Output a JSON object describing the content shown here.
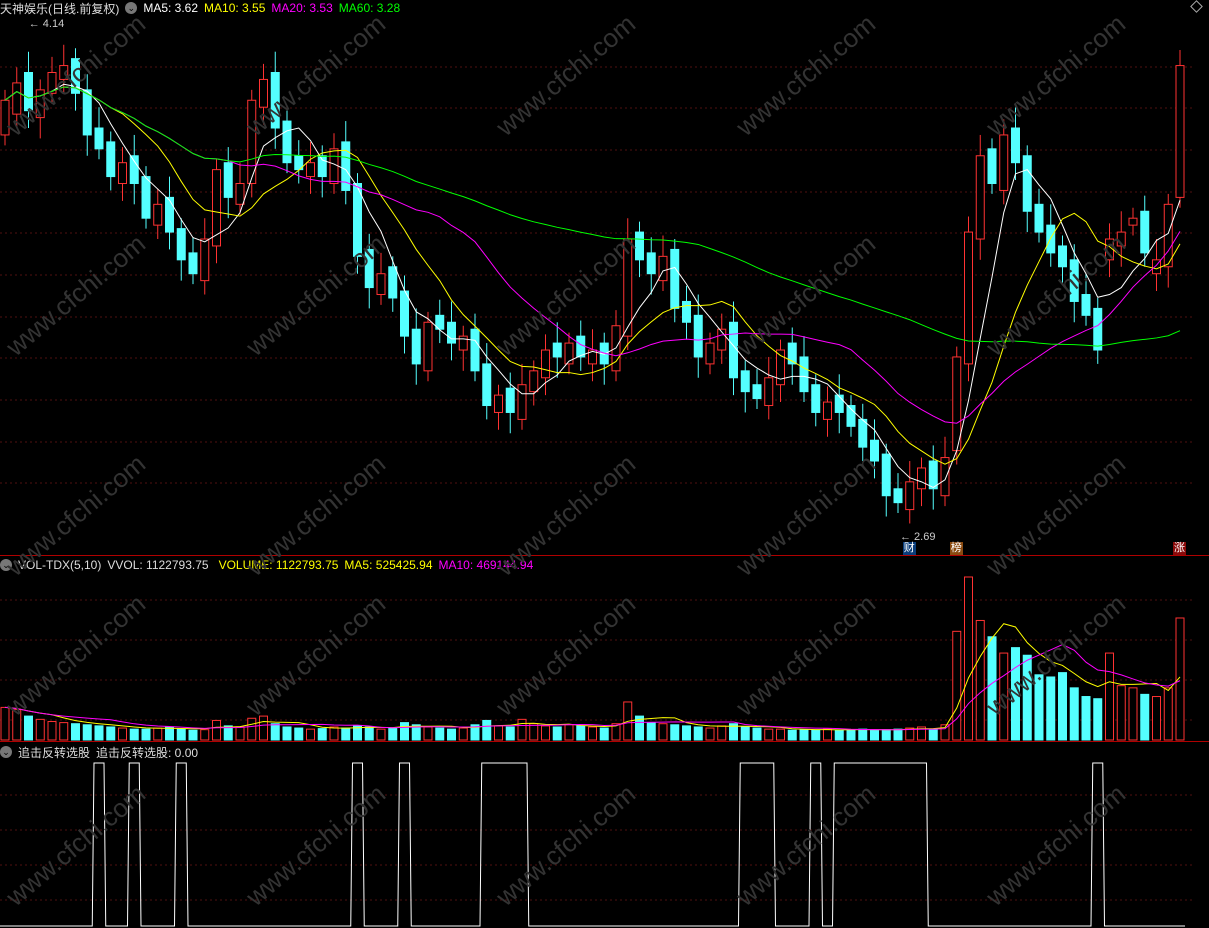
{
  "title": "天神娱乐(日线.前复权)",
  "ma_header": [
    {
      "label": "MA5: 3.62",
      "color": "#ffffff"
    },
    {
      "label": "MA10: 3.55",
      "color": "#ffff00"
    },
    {
      "label": "MA20: 3.53",
      "color": "#ff00ff"
    },
    {
      "label": "MA60: 3.28",
      "color": "#00ff00"
    }
  ],
  "vol_header": {
    "name": "VOL-TDX(5,10)",
    "vvol": "VVOL: 1122793.75",
    "volume": "VOLUME: 1122793.75",
    "ma5": "MA5: 525425.94",
    "ma10": "MA10: 469144.94"
  },
  "ind_header": {
    "name": "追击反转选股",
    "value": "追击反转选股: 0.00"
  },
  "annotations": {
    "high": "4.14",
    "low": "2.69"
  },
  "markers": [
    {
      "text": "财",
      "color": "#0a3d7a",
      "index": 77
    },
    {
      "text": "榜",
      "color": "#8a4a10",
      "index": 81
    },
    {
      "text": "涨",
      "color": "#8a0a0a",
      "index": 100
    }
  ],
  "watermark": "www.cfchi.com",
  "colors": {
    "up": "#ff3232",
    "down": "#54ffff",
    "ma5": "#ffffff",
    "ma10": "#ffff00",
    "ma20": "#ff00ff",
    "ma60": "#00ff00"
  },
  "chart_data": {
    "type": "candlestick",
    "price_range": [
      2.69,
      4.14
    ],
    "close": [
      3.9,
      3.95,
      3.87,
      3.93,
      3.98,
      4.0,
      3.92,
      3.8,
      3.76,
      3.68,
      3.72,
      3.66,
      3.56,
      3.6,
      3.52,
      3.44,
      3.4,
      3.5,
      3.7,
      3.62,
      3.66,
      3.9,
      3.96,
      3.82,
      3.72,
      3.7,
      3.72,
      3.68,
      3.76,
      3.64,
      3.45,
      3.36,
      3.4,
      3.33,
      3.22,
      3.14,
      3.26,
      3.24,
      3.2,
      3.22,
      3.12,
      3.02,
      3.05,
      3.0,
      3.08,
      3.12,
      3.18,
      3.16,
      3.2,
      3.16,
      3.18,
      3.14,
      3.25,
      3.5,
      3.44,
      3.4,
      3.45,
      3.3,
      3.26,
      3.16,
      3.2,
      3.24,
      3.1,
      3.06,
      3.04,
      3.1,
      3.18,
      3.14,
      3.06,
      3.0,
      3.03,
      3.0,
      2.96,
      2.9,
      2.86,
      2.76,
      2.74,
      2.8,
      2.84,
      2.78,
      2.87,
      3.16,
      3.52,
      3.74,
      3.66,
      3.8,
      3.72,
      3.58,
      3.52,
      3.46,
      3.42,
      3.32,
      3.28,
      3.18,
      3.5,
      3.52,
      3.56,
      3.46,
      3.44,
      3.6,
      4.0
    ],
    "open": [
      3.8,
      3.86,
      3.98,
      3.85,
      3.92,
      3.96,
      4.02,
      3.93,
      3.82,
      3.78,
      3.66,
      3.74,
      3.68,
      3.54,
      3.62,
      3.53,
      3.46,
      3.38,
      3.48,
      3.72,
      3.6,
      3.66,
      3.88,
      3.98,
      3.84,
      3.74,
      3.68,
      3.74,
      3.66,
      3.78,
      3.66,
      3.47,
      3.34,
      3.42,
      3.35,
      3.24,
      3.12,
      3.28,
      3.26,
      3.18,
      3.24,
      3.14,
      3.0,
      3.07,
      2.98,
      3.06,
      3.1,
      3.2,
      3.14,
      3.22,
      3.14,
      3.2,
      3.12,
      3.22,
      3.52,
      3.46,
      3.38,
      3.47,
      3.32,
      3.28,
      3.14,
      3.18,
      3.26,
      3.12,
      3.08,
      3.02,
      3.08,
      3.2,
      3.16,
      3.08,
      2.98,
      3.05,
      3.02,
      2.98,
      2.92,
      2.88,
      2.78,
      2.72,
      2.78,
      2.86,
      2.76,
      2.89,
      3.14,
      3.5,
      3.76,
      3.64,
      3.82,
      3.74,
      3.6,
      3.54,
      3.48,
      3.44,
      3.34,
      3.3,
      3.44,
      3.48,
      3.54,
      3.58,
      3.4,
      3.42,
      3.62
    ],
    "volume": [
      300000,
      280000,
      220000,
      190000,
      170000,
      160000,
      150000,
      140000,
      130000,
      120000,
      110000,
      100000,
      100000,
      110000,
      120000,
      100000,
      90000,
      95000,
      180000,
      130000,
      120000,
      200000,
      220000,
      150000,
      120000,
      110000,
      100000,
      105000,
      120000,
      110000,
      130000,
      120000,
      100000,
      110000,
      160000,
      140000,
      120000,
      110000,
      100000,
      110000,
      140000,
      180000,
      130000,
      120000,
      190000,
      150000,
      130000,
      120000,
      140000,
      130000,
      120000,
      110000,
      150000,
      350000,
      220000,
      160000,
      150000,
      140000,
      130000,
      120000,
      110000,
      130000,
      150000,
      120000,
      110000,
      100000,
      100000,
      90000,
      95000,
      90000,
      100000,
      90000,
      95000,
      100000,
      90000,
      95000,
      100000,
      110000,
      120000,
      100000,
      140000,
      1000000,
      1500000,
      1100000,
      950000,
      800000,
      850000,
      780000,
      600000,
      580000,
      620000,
      480000,
      400000,
      380000,
      800000,
      500000,
      480000,
      420000,
      400000,
      480000,
      1122793.75
    ],
    "signal": [
      0,
      0,
      0,
      0,
      0,
      0,
      0,
      0,
      1,
      0,
      0,
      1,
      0,
      0,
      0,
      1,
      0,
      0,
      0,
      0,
      0,
      0,
      0,
      0,
      0,
      0,
      0,
      0,
      0,
      0,
      1,
      0,
      0,
      0,
      1,
      0,
      0,
      0,
      0,
      0,
      0,
      1,
      1,
      1,
      1,
      0,
      0,
      0,
      0,
      0,
      0,
      0,
      0,
      0,
      0,
      0,
      0,
      0,
      0,
      0,
      0,
      0,
      0,
      1,
      1,
      1,
      0,
      0,
      0,
      1,
      0,
      1,
      1,
      1,
      1,
      1,
      1,
      1,
      1,
      0,
      0,
      0,
      0,
      0,
      0,
      0,
      0,
      0,
      0,
      0,
      0,
      0,
      0,
      1,
      0,
      0,
      0,
      0,
      0,
      0,
      0
    ]
  }
}
